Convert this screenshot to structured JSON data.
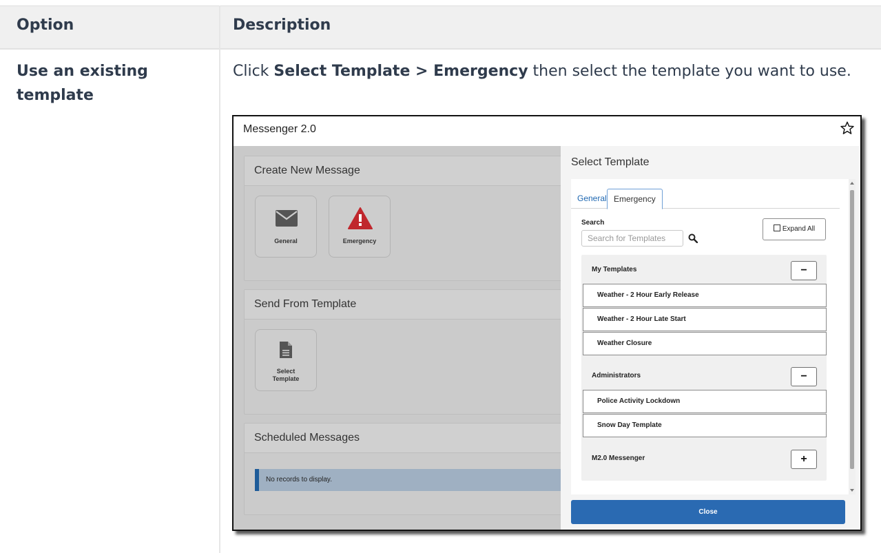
{
  "table": {
    "header_option": "Option",
    "header_description": "Description",
    "row_option": "Use an existing template",
    "desc_prefix": "Click ",
    "desc_bold": "Select Template > Emergency",
    "desc_suffix": " then select the template you want to use."
  },
  "screenshot": {
    "app_title": "Messenger 2.0",
    "create_panel_title": "Create New Message",
    "tile_general": "General",
    "tile_emergency": "Emergency",
    "send_panel_title": "Send From Template",
    "tile_select_line1": "Select",
    "tile_select_line2": "Template",
    "scheduled_panel_title": "Scheduled Messages",
    "no_records": "No records to display.",
    "drawer_title": "Select Template",
    "tabs": [
      "General",
      "Emergency"
    ],
    "search_label": "Search",
    "search_placeholder": "Search for Templates",
    "expand_all": "Expand All",
    "groups": [
      {
        "label": "My Templates",
        "toggle": "−",
        "items": [
          "Weather - 2 Hour Early Release",
          "Weather - 2 Hour Late Start",
          "Weather Closure"
        ]
      },
      {
        "label": "Administrators",
        "toggle": "−",
        "items": [
          "Police Activity Lockdown",
          "Snow Day Template"
        ]
      },
      {
        "label": "M2.0 Messenger",
        "toggle": "+",
        "items": []
      }
    ],
    "close_label": "Close",
    "colors": {
      "accent": "#2a6ab2",
      "emergency_red": "#c0272d",
      "tab_blue": "#1e67b1"
    }
  }
}
